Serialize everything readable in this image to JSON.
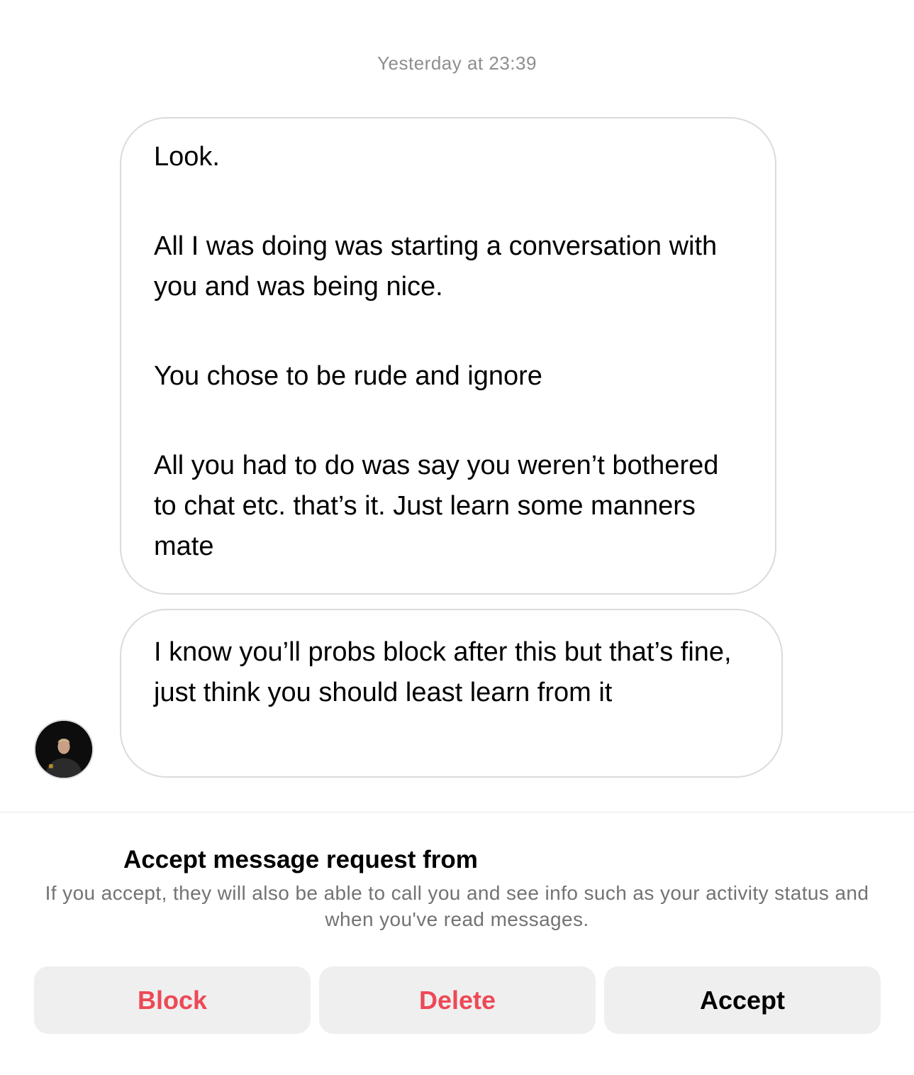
{
  "thread": {
    "timestamp": "Yesterday at 23:39"
  },
  "messages": [
    {
      "paragraphs": [
        "Look.",
        "All I was doing was starting a conversation with you and was being nice.",
        "You chose to be rude and ignore",
        "All you had to do was say you weren’t bothered to chat etc. that’s it. Just learn some manners mate"
      ]
    },
    {
      "paragraphs": [
        "I know you’ll probs block after this but that’s fine, just think you should least learn from it"
      ]
    }
  ],
  "request": {
    "title": "Accept message request from",
    "info": "If you accept, they will also be able to call you and see info such as your activity status and when you've read messages."
  },
  "actions": {
    "block_label": "Block",
    "delete_label": "Delete",
    "accept_label": "Accept"
  },
  "colors": {
    "destructive": "#ed4956",
    "button_background": "#efefef",
    "bubble_border": "#dbdbdb",
    "secondary_text": "#8e8e8e"
  }
}
